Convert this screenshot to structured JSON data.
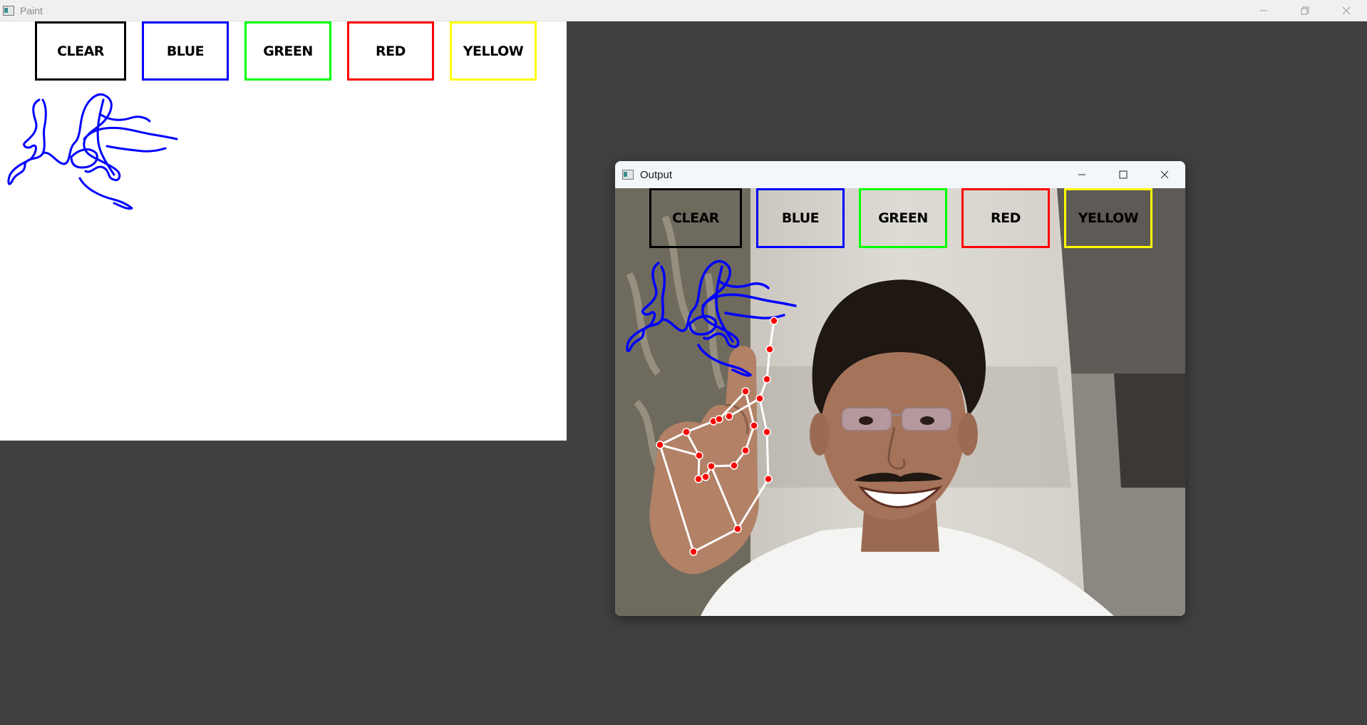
{
  "paint_window": {
    "title": "Paint",
    "icon": "app-window-icon",
    "controls": [
      "minimize-icon",
      "restore-icon",
      "close-icon"
    ]
  },
  "output_window": {
    "title": "Output",
    "icon": "app-window-icon",
    "controls": [
      "minimize-icon",
      "maximize-icon",
      "close-icon"
    ]
  },
  "color_buttons": [
    {
      "label": "CLEAR",
      "color": "#000000"
    },
    {
      "label": "BLUE",
      "color": "#0000ff"
    },
    {
      "label": "GREEN",
      "color": "#00ff00"
    },
    {
      "label": "RED",
      "color": "#ff0000"
    },
    {
      "label": "YELLOW",
      "color": "#ffff00"
    }
  ],
  "colors": {
    "desktop_background": "#404040",
    "stroke": "#0000ff",
    "landmark_point": "#ff0000",
    "landmark_line": "#ffffff"
  }
}
